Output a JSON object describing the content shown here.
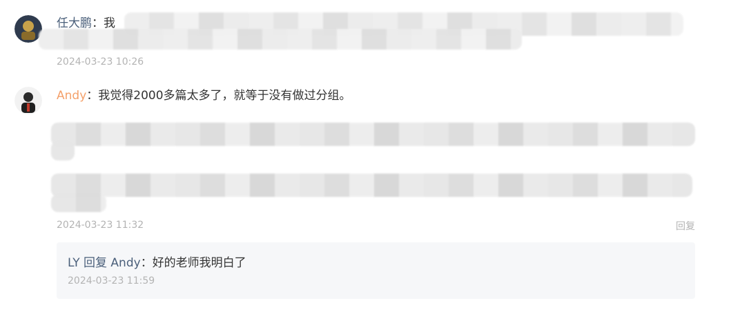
{
  "comments": [
    {
      "author": "任大鹏",
      "separator": "：",
      "text": "我",
      "time": "2024-03-23 10:26"
    },
    {
      "author": "Andy",
      "separator": "：",
      "text": "我觉得2000多篇太多了，就等于没有做过分组。",
      "time": "2024-03-23 11:32",
      "reply_label": "回复"
    }
  ],
  "reply": {
    "author": "LY",
    "reply_word": " 回复 ",
    "target": "Andy",
    "separator": "：",
    "text": "好的老师我明白了",
    "time": "2024-03-23 11:59"
  },
  "colors": {
    "author_blue": "#4a5f7a",
    "author_orange": "#f4a06a",
    "timestamp": "#b3b3b3",
    "reply_bg": "#f6f7f9"
  },
  "icons": {
    "avatar1": "avatar-icon",
    "avatar2": "avatar-icon"
  }
}
